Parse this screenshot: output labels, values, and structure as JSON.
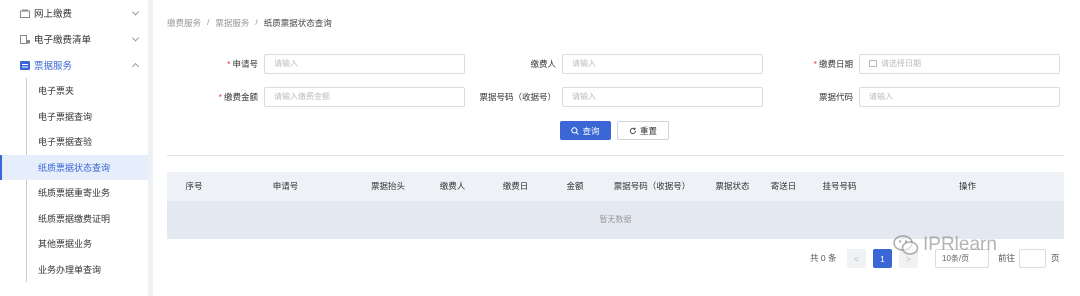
{
  "sidebar": {
    "groups": [
      {
        "label": "网上缴费"
      },
      {
        "label": "电子缴费清单"
      },
      {
        "label": "票据服务"
      }
    ],
    "items": [
      {
        "label": "电子票夹"
      },
      {
        "label": "电子票据查询"
      },
      {
        "label": "电子票据查验"
      },
      {
        "label": "纸质票据状态查询"
      },
      {
        "label": "纸质票据重寄业务"
      },
      {
        "label": "纸质票据缴费证明"
      },
      {
        "label": "其他票据业务"
      },
      {
        "label": "业务办理单查询"
      }
    ]
  },
  "breadcrumb": {
    "home": "缴费服务",
    "sep": "/",
    "parent": "票据服务",
    "current": "纸质票据状态查询"
  },
  "form": {
    "req_mark": "*",
    "application_no": {
      "label": "申请号",
      "placeholder": "请输入"
    },
    "payer": {
      "label": "缴费人",
      "placeholder": "请输入"
    },
    "pay_date": {
      "label": "缴费日期",
      "placeholder": "请选择日期"
    },
    "amount": {
      "label": "缴费金额",
      "placeholder": "请输入缴费金额"
    },
    "receipt_no": {
      "label": "票据号码（收据号）",
      "placeholder": "请输入"
    },
    "receipt_code": {
      "label": "票据代码",
      "placeholder": "请输入"
    }
  },
  "buttons": {
    "search": "查询",
    "reset": "重置"
  },
  "table": {
    "columns": [
      "序号",
      "申请号",
      "票据抬头",
      "缴费人",
      "缴费日",
      "金额",
      "票据号码（收据号）",
      "票据状态",
      "寄送日",
      "挂号号码",
      "操作"
    ],
    "empty_text": "暂无数据"
  },
  "pagination": {
    "total": "共 0 条",
    "prev": "<",
    "current_page": "1",
    "next": ">",
    "page_size": "10条/页",
    "jump_label": "前往",
    "page_unit": "页"
  },
  "watermark": {
    "text": "IPRlearn"
  },
  "colors": {
    "primary": "#3a66d6",
    "required": "#e33333"
  }
}
